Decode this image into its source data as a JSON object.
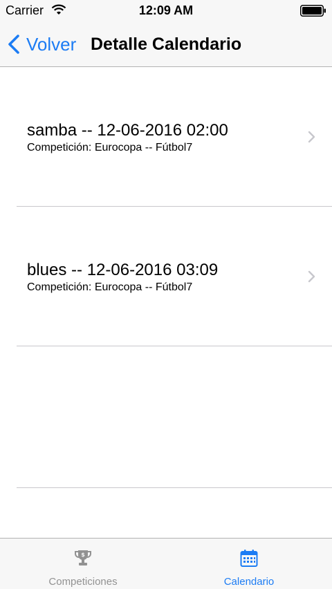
{
  "status_bar": {
    "carrier": "Carrier",
    "time": "12:09 AM"
  },
  "nav": {
    "back_label": "Volver",
    "title": "Detalle Calendario"
  },
  "rows": [
    {
      "title": "samba -- 12-06-2016 02:00",
      "subtitle": "Competición: Eurocopa -- Fútbol7"
    },
    {
      "title": "blues -- 12-06-2016 03:09",
      "subtitle": "Competición: Eurocopa -- Fútbol7"
    }
  ],
  "tabs": [
    {
      "label": "Competiciones",
      "icon": "trophy-icon",
      "selected": false
    },
    {
      "label": "Calendario",
      "icon": "calendar-icon",
      "selected": true
    }
  ],
  "colors": {
    "accent": "#1c7cf4",
    "tab_inactive": "#929292",
    "separator": "#c8c7cc",
    "bar_background": "#f7f7f7"
  }
}
